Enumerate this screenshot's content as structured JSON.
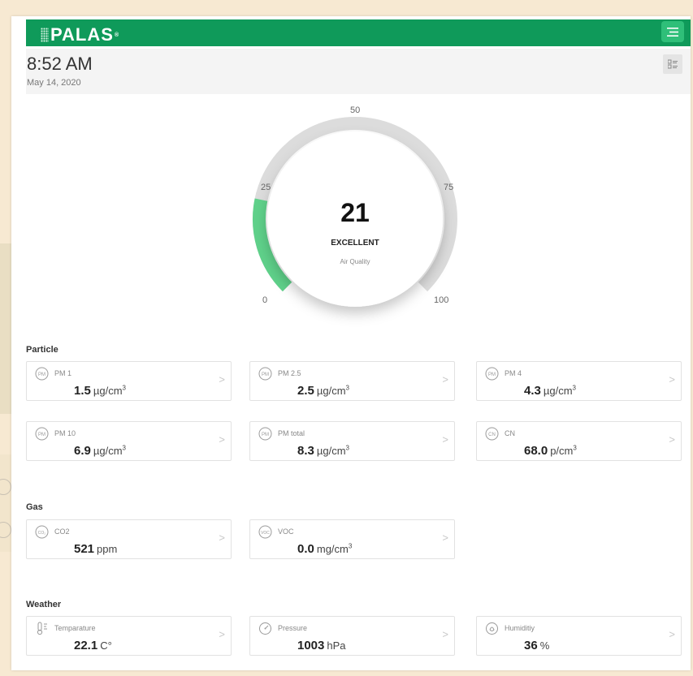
{
  "header": {
    "logo": "PALAS",
    "logo_mark": "®"
  },
  "time_panel": {
    "time": "8:52 AM",
    "date": "May 14, 2020"
  },
  "gauge": {
    "value": "21",
    "value_fraction": 0.21,
    "status": "EXCELLENT",
    "caption": "Air Quality",
    "ticks": {
      "t0": "0",
      "t25": "25",
      "t50": "50",
      "t75": "75",
      "t100": "100"
    },
    "colors": {
      "fill": "#5fd18a",
      "track": "#dcdcdc"
    }
  },
  "sections": {
    "particle": {
      "title": "Particle",
      "cards": [
        {
          "label": "PM 1",
          "value": "1.5",
          "unit": "µg/cm",
          "sup": "3",
          "icon": "pm-icon"
        },
        {
          "label": "PM 2.5",
          "value": "2.5",
          "unit": "µg/cm",
          "sup": "3",
          "icon": "pm-icon"
        },
        {
          "label": "PM 4",
          "value": "4.3",
          "unit": "µg/cm",
          "sup": "3",
          "icon": "pm-icon"
        },
        {
          "label": "PM 10",
          "value": "6.9",
          "unit": "µg/cm",
          "sup": "3",
          "icon": "pm-icon"
        },
        {
          "label": "PM total",
          "value": "8.3",
          "unit": "µg/cm",
          "sup": "3",
          "icon": "pm-icon"
        },
        {
          "label": "CN",
          "value": "68.0",
          "unit": "p/cm",
          "sup": "3",
          "icon": "cn-icon"
        }
      ]
    },
    "gas": {
      "title": "Gas",
      "cards": [
        {
          "label": "CO2",
          "value": "521",
          "unit": "ppm",
          "sup": "",
          "icon": "co2-icon"
        },
        {
          "label": "VOC",
          "value": "0.0",
          "unit": "mg/cm",
          "sup": "3",
          "icon": "voc-icon"
        }
      ]
    },
    "weather": {
      "title": "Weather",
      "cards": [
        {
          "label": "Temparature",
          "value": "22.1",
          "unit": "C°",
          "sup": "",
          "icon": "thermometer-icon"
        },
        {
          "label": "Pressure",
          "value": "1003",
          "unit": "hPa",
          "sup": "",
          "icon": "gauge-icon"
        },
        {
          "label": "Humiditiy",
          "value": "36",
          "unit": "%",
          "sup": "",
          "icon": "humidity-icon"
        }
      ]
    }
  },
  "colors": {
    "brand": "#0f9a5a",
    "menu": "#2fbf79",
    "card_border": "#e2e2e2"
  }
}
